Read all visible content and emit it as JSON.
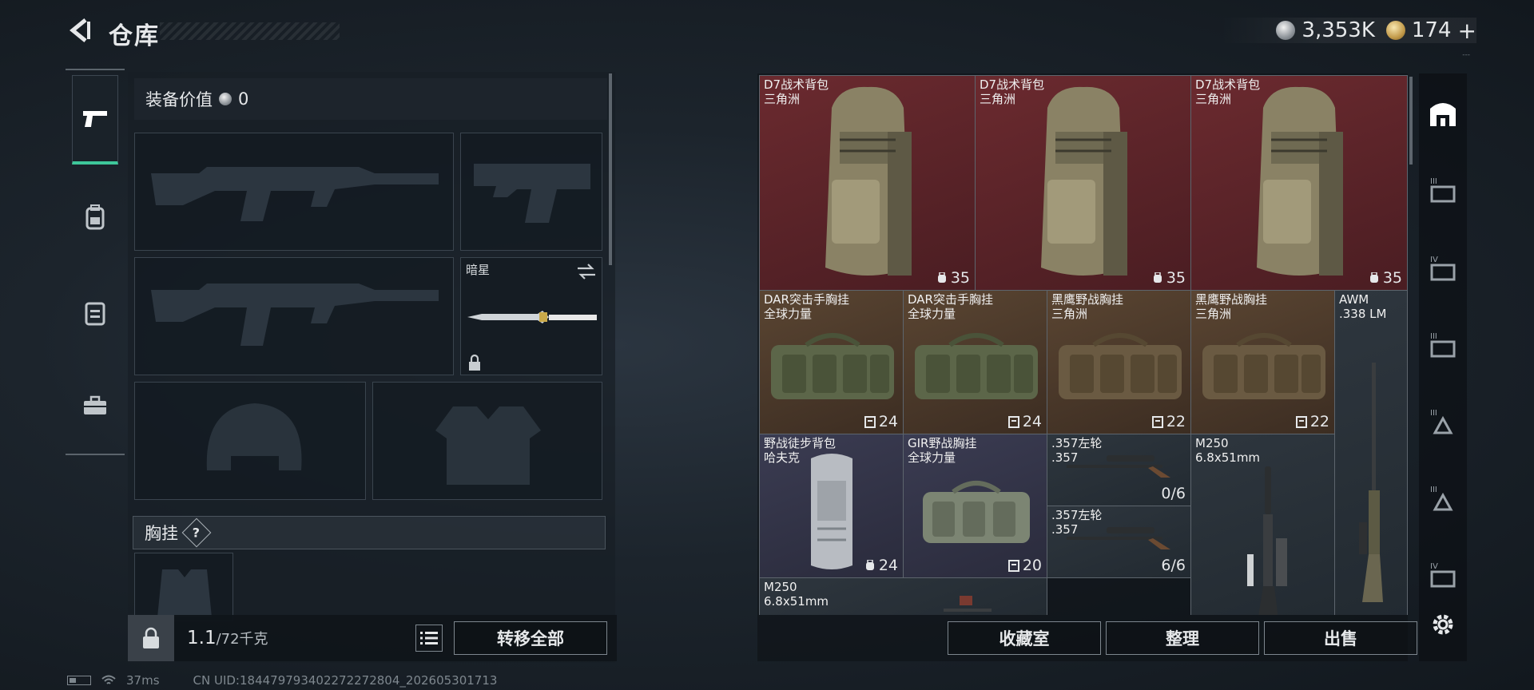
{
  "header": {
    "title": "仓库",
    "currency_silver": "3,353K",
    "currency_gold": "174",
    "add_label": "+",
    "version": "---"
  },
  "loadout": {
    "value_label": "装备价值",
    "value_amount": "0",
    "melee_name": "暗星",
    "chest_section_label": "胸挂",
    "help_label": "?",
    "weight_current": "1.1",
    "weight_capacity": "/72千克",
    "transfer_all_label": "转移全部"
  },
  "stash": {
    "items": [
      {
        "name": "D7战术背包\n三角洲",
        "count": "35",
        "rarity": "red"
      },
      {
        "name": "D7战术背包\n三角洲",
        "count": "35",
        "rarity": "red"
      },
      {
        "name": "D7战术背包\n三角洲",
        "count": "35",
        "rarity": "red"
      },
      {
        "name": "DAR突击手胸挂\n全球力量",
        "count": "24",
        "rarity": "brown"
      },
      {
        "name": "DAR突击手胸挂\n全球力量",
        "count": "24",
        "rarity": "brown"
      },
      {
        "name": "黑鹰野战胸挂\n三角洲",
        "count": "22",
        "rarity": "brown"
      },
      {
        "name": "黑鹰野战胸挂\n三角洲",
        "count": "22",
        "rarity": "brown"
      },
      {
        "name": "AWM\n.338 LM",
        "count": "",
        "rarity": "grey"
      },
      {
        "name": "野战徒步背包\n哈夫克",
        "count": "24",
        "rarity": "purple"
      },
      {
        "name": "GIR野战胸挂\n全球力量",
        "count": "20",
        "rarity": "purple"
      },
      {
        "name": ".357左轮\n.357",
        "count": "0/6",
        "rarity": "grey"
      },
      {
        "name": ".357左轮\n.357",
        "count": "6/6",
        "rarity": "grey"
      },
      {
        "name": "M250\n6.8x51mm",
        "count": "",
        "rarity": "grey"
      },
      {
        "name": "M250\n6.8x51mm",
        "count": "",
        "rarity": "grey"
      }
    ],
    "collection_label": "收藏室",
    "sort_label": "整理",
    "sell_label": "出售"
  },
  "status": {
    "ping": "37ms",
    "uid": "CN UID:18447979340227227280​4_202605301713"
  },
  "colors": {
    "accent_green": "#3ec79a",
    "rarity_red": "#6b2a2f",
    "rarity_brown": "#5a4532",
    "rarity_purple": "#3b3c52"
  }
}
